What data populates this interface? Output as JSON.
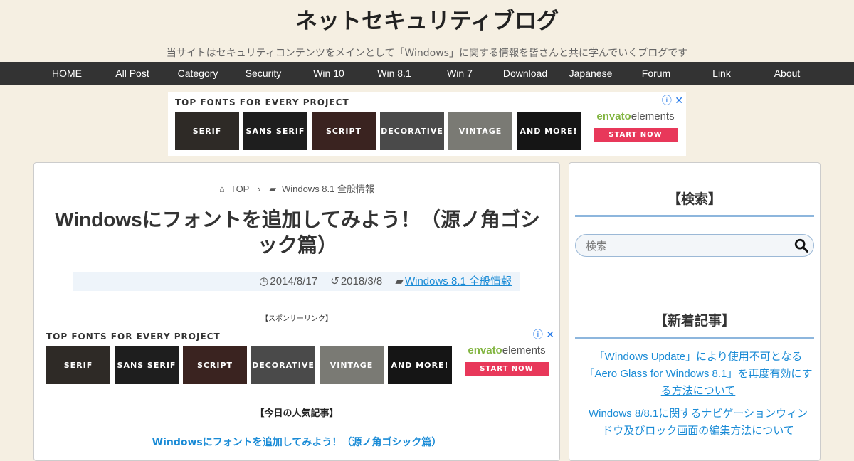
{
  "header": {
    "title": "ネットセキュリティブログ",
    "description": "当サイトはセキュリティコンテンツをメインとして「Windows」に関する情報を皆さんと共に学んでいくブログです"
  },
  "nav": {
    "items": [
      "HOME",
      "All Post",
      "Category",
      "Security",
      "Win 10",
      "Win 8.1",
      "Win 7",
      "Download",
      "Japanese",
      "Forum",
      "Link",
      "About"
    ]
  },
  "ad": {
    "title": "TOP FONTS FOR EVERY PROJECT",
    "tiles": [
      "SERIF",
      "SANS SERIF",
      "SCRIPT",
      "DECORATIVE",
      "VINTAGE",
      "AND MORE!"
    ],
    "brand_prefix": "envato",
    "brand_suffix": "elements",
    "cta": "START NOW",
    "close_glyph": "ⓘ ✕"
  },
  "breadcrumb": {
    "home": "TOP",
    "category": "Windows 8.1 全般情報"
  },
  "post": {
    "title": "Windowsにフォントを追加してみよう！（源ノ角ゴシック篇）",
    "published": "2014/8/17",
    "updated": "2018/3/8",
    "category": "Windows 8.1 全般情報",
    "sponsor_label": "【スポンサーリンク】",
    "popular_heading": "【今日の人気記事】",
    "popular_link": "Windowsにフォントを追加してみよう！（源ノ角ゴシック篇）"
  },
  "sidebar": {
    "search_title": "【検索】",
    "search_placeholder": "検索",
    "new_title": "【新着記事】",
    "new_posts": [
      "「Windows Update」により使用不可となる「Aero Glass for Windows 8.1」を再度有効にする方法について",
      "Windows 8/8.1に関するナビゲーションウィンドウ及びロック画面の編集方法について"
    ]
  },
  "colors": {
    "nav_bg": "#333333",
    "link": "#1a8bd6",
    "accent_border": "#8db6dd",
    "cta": "#e8385a"
  }
}
